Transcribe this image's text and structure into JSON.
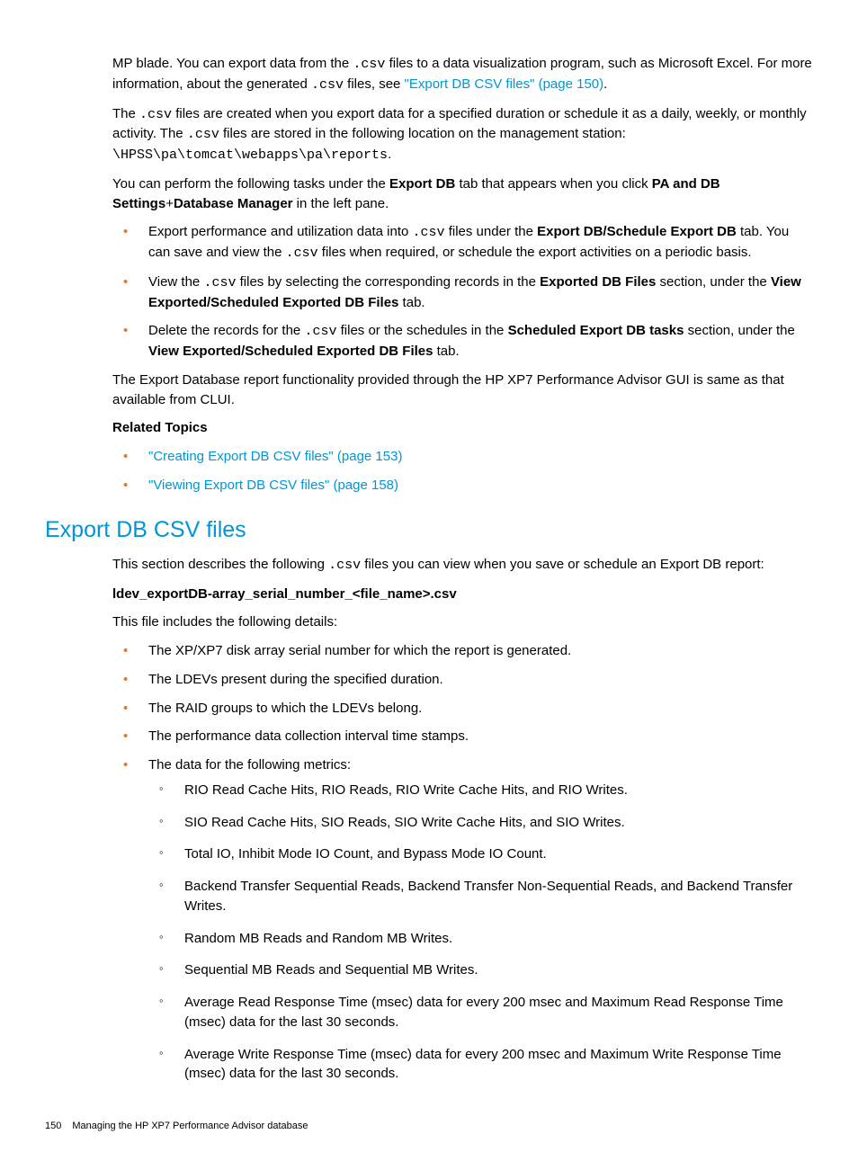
{
  "p1_a": "MP blade. You can export data from the ",
  "p1_code1": ".csv",
  "p1_b": " files to a data visualization program, such as Microsoft Excel. For more information, about the generated ",
  "p1_code2": ".csv",
  "p1_c": " files, see ",
  "p1_link": "\"Export DB CSV files\" (page 150)",
  "p1_d": ".",
  "p2_a": "The ",
  "p2_code1": ".csv",
  "p2_b": " files are created when you export data for a specified duration or schedule it as a daily, weekly, or monthly activity. The ",
  "p2_code2": ".csv",
  "p2_c": " files are stored in the following location on the management station: ",
  "p2_code3": "\\HPSS\\pa\\tomcat\\webapps\\pa\\reports",
  "p2_d": ".",
  "p3_a": "You can perform the following tasks under the ",
  "p3_bold1": "Export DB",
  "p3_b": " tab that appears when you click ",
  "p3_bold2": "PA and DB Settings",
  "p3_c": "+",
  "p3_bold3": "Database Manager",
  "p3_d": " in the left pane.",
  "li1_a": "Export performance and utilization data into ",
  "li1_code": ".csv",
  "li1_b": " files under the ",
  "li1_bold": "Export DB/Schedule Export DB",
  "li1_c": " tab. You can save and view the ",
  "li1_code2": ".csv",
  "li1_d": " files when required, or schedule the export activities on a periodic basis.",
  "li2_a": "View the ",
  "li2_code": ".csv",
  "li2_b": " files by selecting the corresponding records in the ",
  "li2_bold1": "Exported DB Files",
  "li2_c": " section, under the ",
  "li2_bold2": "View Exported/Scheduled Exported DB Files",
  "li2_d": " tab.",
  "li3_a": "Delete the records for the ",
  "li3_code": ".csv",
  "li3_b": " files or the schedules in the ",
  "li3_bold1": "Scheduled Export DB tasks",
  "li3_c": " section, under the ",
  "li3_bold2": "View Exported/Scheduled Exported DB Files",
  "li3_d": " tab.",
  "p4": "The Export Database report functionality provided through the HP XP7 Performance Advisor GUI is same as that available from CLUI.",
  "related_heading": "Related Topics",
  "related1": "\"Creating Export DB CSV files\" (page 153)",
  "related2": "\"Viewing Export DB CSV files\" (page 158)",
  "section_heading": "Export DB CSV files",
  "s_p1_a": "This section describes the following ",
  "s_p1_code": ".csv",
  "s_p1_b": " files you can view when you save or schedule an Export DB report:",
  "s_bold_filename": "ldev_exportDB-array_serial_number_<file_name>.csv",
  "s_p2": "This file includes the following details:",
  "sli1": "The XP/XP7 disk array serial number for which the report is generated.",
  "sli2": "The LDEVs present during the specified duration.",
  "sli3": "The RAID groups to which the LDEVs belong.",
  "sli4": "The performance data collection interval time stamps.",
  "sli5": "The data for the following metrics:",
  "sub1": "RIO Read Cache Hits, RIO Reads, RIO Write Cache Hits, and RIO Writes.",
  "sub2": "SIO Read Cache Hits, SIO Reads, SIO Write Cache Hits, and SIO Writes.",
  "sub3": "Total IO, Inhibit Mode IO Count, and Bypass Mode IO Count.",
  "sub4": "Backend Transfer Sequential Reads, Backend Transfer Non-Sequential Reads, and Backend Transfer Writes.",
  "sub5": "Random MB Reads and Random MB Writes.",
  "sub6": "Sequential MB Reads and Sequential MB Writes.",
  "sub7": "Average Read Response Time (msec) data for every 200 msec and Maximum Read Response Time (msec) data for the last 30 seconds.",
  "sub8": "Average Write Response Time (msec) data for every 200 msec and Maximum Write Response Time (msec) data for the last 30 seconds.",
  "footer_page": "150",
  "footer_text": "Managing the HP XP7 Performance Advisor database"
}
